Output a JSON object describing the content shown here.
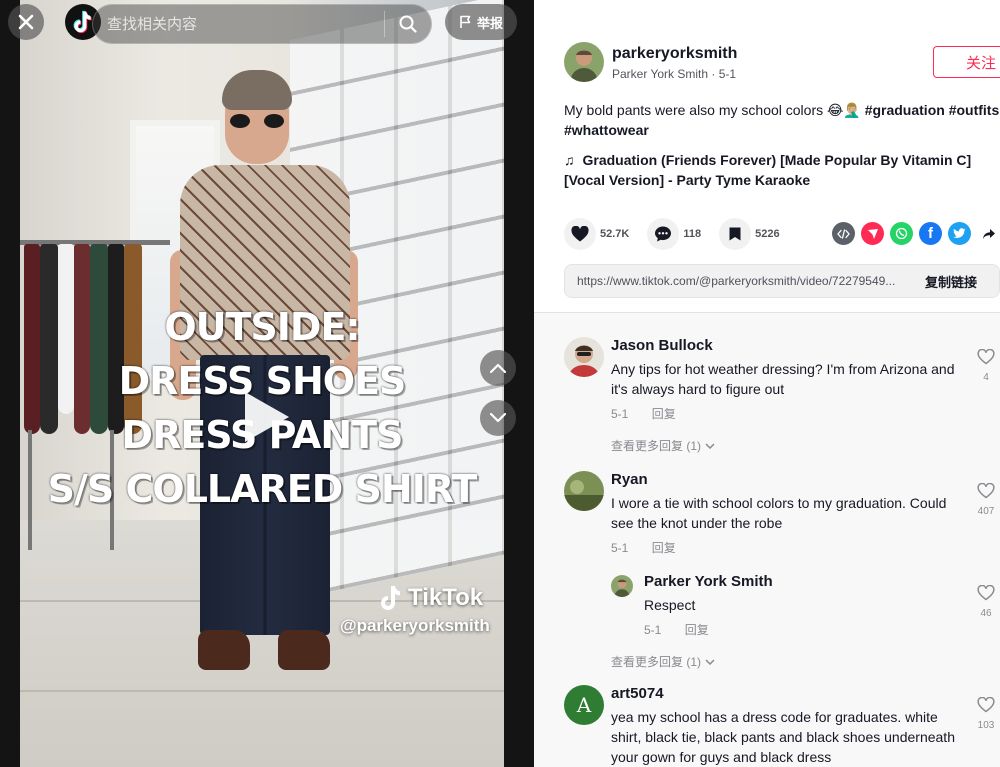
{
  "video": {
    "caption_lines": [
      "OUTSIDE:",
      "DRESS SHOES",
      "DRESS PANTS",
      "S/S COLLARED SHIRT"
    ],
    "watermark_brand": "TikTok",
    "watermark_handle": "@parkeryorksmith"
  },
  "topbar": {
    "search_placeholder": "查找相关内容",
    "report_label": "举报"
  },
  "author": {
    "handle": "parkeryorksmith",
    "display_name": "Parker York Smith",
    "separator": " · ",
    "date": "5-1",
    "follow_label": "关注"
  },
  "post": {
    "description": "My bold pants were also my school colors 😂🤦🏼‍♂️",
    "hashtags": [
      "#graduation",
      "#outfits",
      "#whattowear"
    ],
    "music": "Graduation (Friends Forever) [Made Popular By Vitamin C] [Vocal Version] - Party Tyme Karaoke"
  },
  "stats": {
    "likes": "52.7K",
    "comments": "118",
    "saves": "5226"
  },
  "share": {
    "link": "https://www.tiktok.com/@parkeryorksmith/video/72279549...",
    "copy_label": "复制链接"
  },
  "comments": [
    {
      "name": "Jason Bullock",
      "text": "Any tips for hot weather dressing? I'm from Arizona and it's always hard to figure out",
      "date": "5-1",
      "reply_label": "回复",
      "likes": "4",
      "view_more": "查看更多回复 (1)"
    },
    {
      "name": "Ryan",
      "text": "I wore a tie with school colors to my graduation. Could see the knot under the robe",
      "date": "5-1",
      "reply_label": "回复",
      "likes": "407",
      "reply": {
        "name": "Parker York Smith",
        "text": "Respect",
        "date": "5-1",
        "reply_label": "回复",
        "likes": "46"
      },
      "view_more": "查看更多回复 (1)"
    },
    {
      "name": "art5074",
      "avatar_letter": "A",
      "text": "yea my school has a dress code for graduates. white shirt, black tie, black pants and black shoes underneath your gown for guys and black dress",
      "likes": "103"
    }
  ],
  "colors": {
    "accent": "#fe2c55",
    "avatar_green": "#2e7d32",
    "pinterest": "#fe2c55",
    "whatsapp": "#25d366",
    "facebook": "#1877f2",
    "twitter": "#1da1f2"
  }
}
